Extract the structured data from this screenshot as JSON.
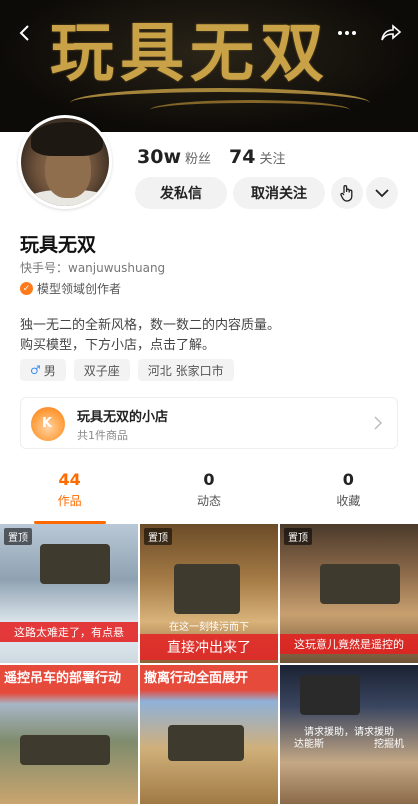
{
  "banner": {
    "title": "玩具无双"
  },
  "profile": {
    "followers_num": "30w",
    "followers_label": "粉丝",
    "following_num": "74",
    "following_label": "关注",
    "msg_button": "发私信",
    "unfollow_button": "取消关注",
    "name": "玩具无双",
    "uid": "快手号：wanjuwushuang",
    "creator": "模型领域创作者",
    "bio_line1": "独一无二的全新风格，数一数二的内容质量。",
    "bio_line2": "购买模型，下方小店，点击了解。",
    "tags": {
      "gender": "男",
      "zodiac": "双子座",
      "location": "河北 张家口市"
    }
  },
  "shop": {
    "title": "玩具无双的小店",
    "subtitle": "共1件商品",
    "logo_letter": "K"
  },
  "tabs": [
    {
      "count": "44",
      "label": "作品"
    },
    {
      "count": "0",
      "label": "动态"
    },
    {
      "count": "0",
      "label": "收藏"
    }
  ],
  "grid": {
    "pin_label": "置顶",
    "c1_caption": "这路太难走了，有点悬",
    "c2_sub": "在这一刻犊污而下",
    "c2_caption": "直接冲出来了",
    "c3_caption": "这玩意儿竟然是遥控的",
    "c4_title": "遥控吊车的部署行动",
    "c5_title": "撤离行动全面展开",
    "c6_caption_top": "请求援助，请求援助",
    "c6_caption": "达能斯　　　　　挖掘机"
  },
  "colors": {
    "accent": "#ff6a00",
    "caption_red": "#e22020"
  }
}
